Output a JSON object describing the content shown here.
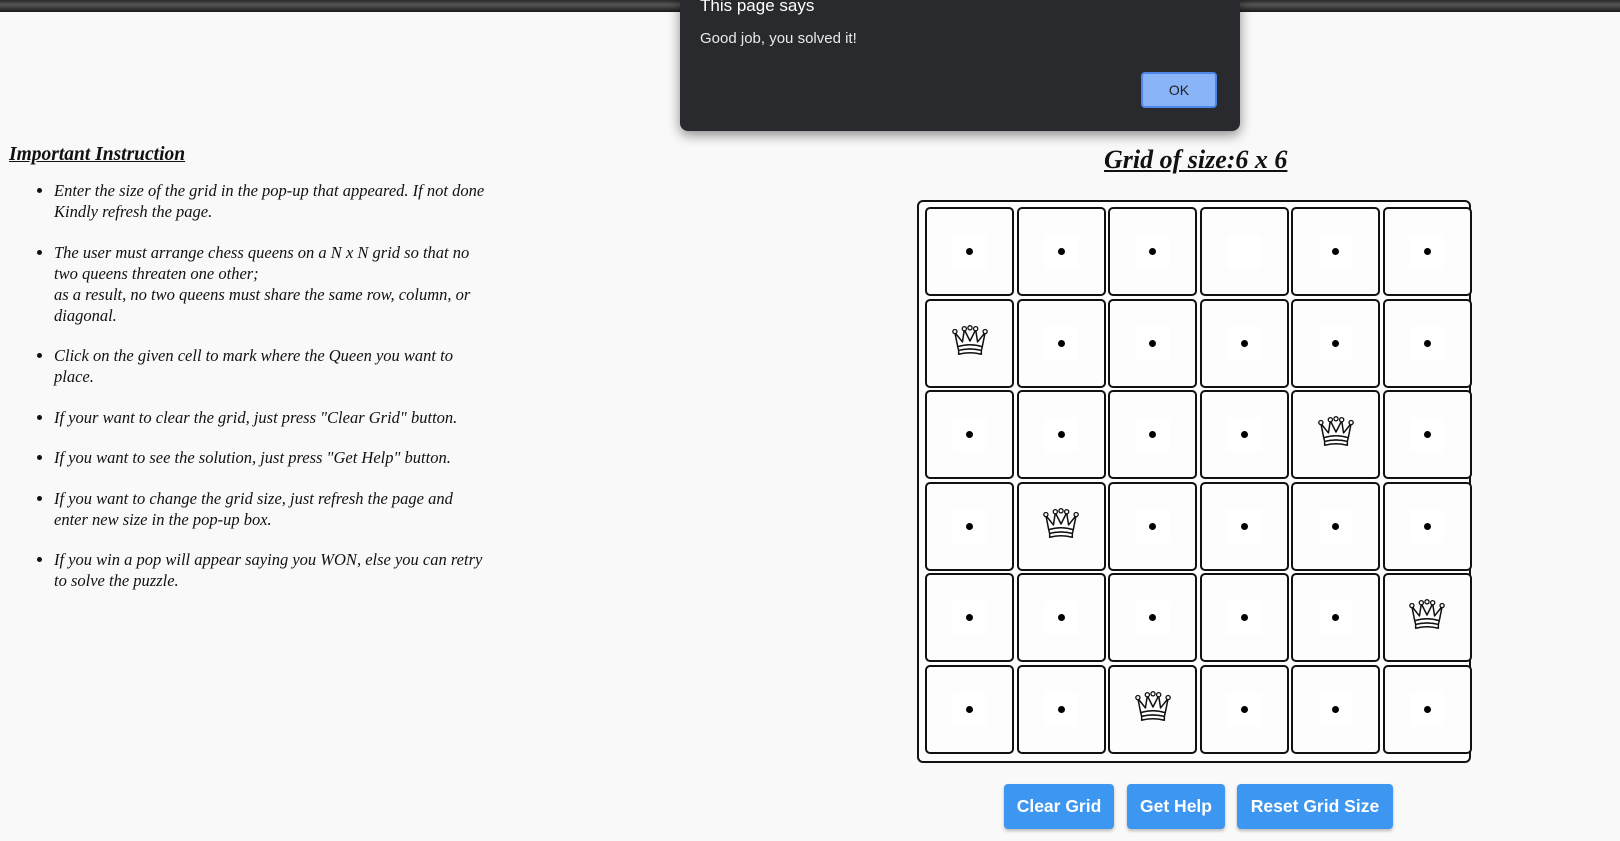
{
  "dialog": {
    "title": "This page says",
    "message": "Good job, you solved it!",
    "ok_label": "OK"
  },
  "instructions": {
    "heading": "Important Instruction",
    "items": [
      [
        "Enter the size of the grid in the pop-up that appeared. If not done Kindly refresh the page."
      ],
      [
        "The user must arrange chess queens on a N x N grid so that no two queens threaten one other;",
        "as a result, no two queens must share the same row, column, or diagonal."
      ],
      [
        "Click on the given cell to mark where the Queen you want to place."
      ],
      [
        "If your want to clear the grid, just press \"Clear Grid\" button."
      ],
      [
        "If you want to see the solution, just press \"Get Help\" button."
      ],
      [
        "If you want to change the grid size, just refresh the page and enter new size in the pop-up box."
      ],
      [
        "If you win a pop will appear saying you WON, else you can retry to solve the puzzle."
      ]
    ]
  },
  "grid": {
    "title": "Grid of size:6 x 6",
    "size": 6,
    "cells": [
      [
        "dot",
        "dot",
        "dot",
        "empty",
        "dot",
        "dot"
      ],
      [
        "queen",
        "dot",
        "dot",
        "dot",
        "dot",
        "dot"
      ],
      [
        "dot",
        "dot",
        "dot",
        "dot",
        "queen",
        "dot"
      ],
      [
        "dot",
        "queen",
        "dot",
        "dot",
        "dot",
        "dot"
      ],
      [
        "dot",
        "dot",
        "dot",
        "dot",
        "dot",
        "queen"
      ],
      [
        "dot",
        "dot",
        "queen",
        "dot",
        "dot",
        "dot"
      ]
    ],
    "icons": {
      "queen": "queen-icon",
      "dot": "dot-icon"
    }
  },
  "buttons": {
    "clear": "Clear Grid",
    "help": "Get Help",
    "reset": "Reset Grid Size"
  },
  "colors": {
    "button": "#3d96f0",
    "dialog_bg": "#292a2d",
    "ok_button": "#8ab4f8"
  }
}
